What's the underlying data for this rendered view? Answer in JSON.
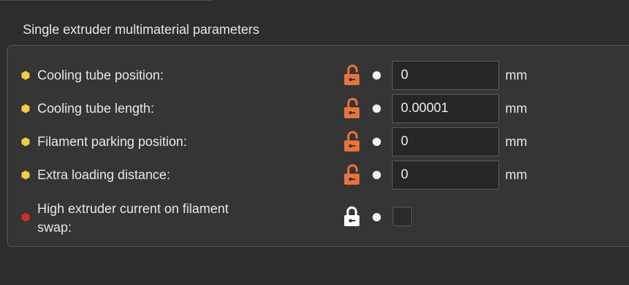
{
  "section": {
    "title": "Single extruder multimaterial parameters"
  },
  "colors": {
    "modified_dot_yellow": "#f3cd3d",
    "modified_dot_red": "#d12a2a",
    "lock_orange": "#e8733a",
    "lock_white": "#ffffff"
  },
  "rows": [
    {
      "label": "Cooling tube position:",
      "value": "0",
      "unit": "mm",
      "lock": "unlocked",
      "dot": "yellow"
    },
    {
      "label": "Cooling tube length:",
      "value": "0.00001",
      "unit": "mm",
      "lock": "unlocked",
      "dot": "yellow"
    },
    {
      "label": "Filament parking position:",
      "value": "0",
      "unit": "mm",
      "lock": "unlocked",
      "dot": "yellow"
    },
    {
      "label": "Extra loading distance:",
      "value": "0",
      "unit": "mm",
      "lock": "unlocked",
      "dot": "yellow"
    }
  ],
  "swap_row": {
    "label_line1": "High extruder current on filament",
    "label_line2": "swap:",
    "checked": false,
    "lock": "locked",
    "dot": "red"
  }
}
